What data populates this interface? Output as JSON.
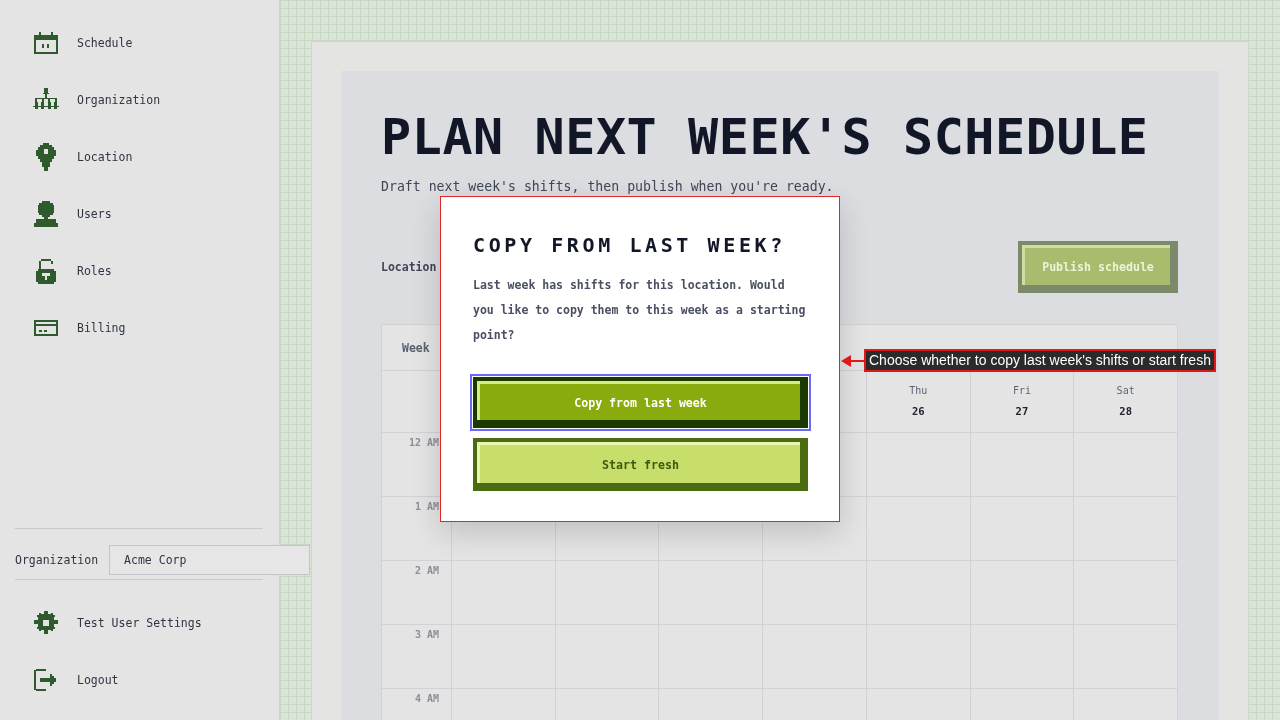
{
  "sidebar": {
    "nav_items": [
      {
        "label": "Schedule"
      },
      {
        "label": "Organization"
      },
      {
        "label": "Location"
      },
      {
        "label": "Users"
      },
      {
        "label": "Roles"
      },
      {
        "label": "Billing"
      }
    ],
    "organization": {
      "label": "Organization",
      "value": "Acme Corp"
    },
    "account_items": [
      {
        "label": "Test User Settings"
      },
      {
        "label": "Logout"
      }
    ]
  },
  "page": {
    "title": "PLAN NEXT WEEK'S SCHEDULE",
    "subtitle": "Draft next week's shifts, then publish when you're ready.",
    "location_label": "Location",
    "publish_button": {
      "label": "Publish schedule",
      "disabled": true
    }
  },
  "calendar": {
    "header": "Week",
    "days": [
      {
        "name": "Thu",
        "date": "26"
      },
      {
        "name": "Fri",
        "date": "27"
      },
      {
        "name": "Sat",
        "date": "28"
      }
    ],
    "hours": [
      "12 AM",
      "1 AM",
      "2 AM",
      "3 AM",
      "4 AM"
    ]
  },
  "modal": {
    "title": "COPY FROM LAST WEEK?",
    "message": "Last week has shifts for this location. Would you like to copy them to this week as a starting point?",
    "buttons": [
      {
        "label": "Copy from last week",
        "kind": "primary",
        "focused": true
      },
      {
        "label": "Start fresh",
        "kind": "secondary",
        "focused": false
      }
    ]
  },
  "annotation": {
    "text": "Choose whether to copy last week's shifts or start fresh"
  }
}
